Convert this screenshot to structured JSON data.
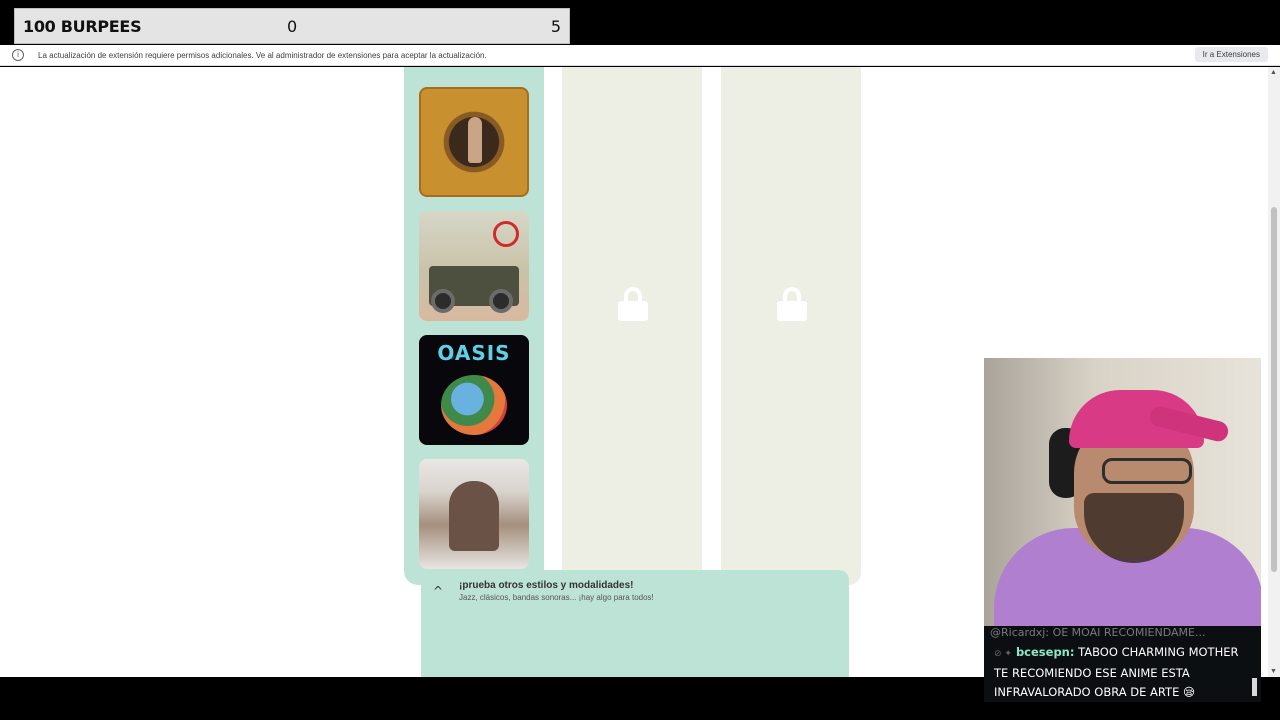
{
  "counter": {
    "label": "100 BURPEES",
    "current": "0",
    "goal": "5"
  },
  "infobar": {
    "icon": "info-icon",
    "message": "La actualización de extensión requiere permisos adicionales. Ve al administrador de extensiones para aceptar la actualización.",
    "button_label": "Ir a Extensiones"
  },
  "albums": [
    {
      "icon": "album-cover-ornate"
    },
    {
      "icon": "album-cover-jeep"
    },
    {
      "title": "OASIS"
    },
    {
      "icon": "album-cover-portrait"
    }
  ],
  "locked_columns": [
    {
      "icon": "lock-icon"
    },
    {
      "icon": "lock-icon"
    }
  ],
  "bottom_panel": {
    "chevron": "^",
    "title": "¡prueba otros estilos y modalidades!",
    "subtitle": "Jazz, clásicos, bandas sonoras... ¡hay algo para todos!"
  },
  "chat": {
    "previous": "@Ricardxj: OE MOAI RECOMIENDAME...",
    "username": "bcesepn:",
    "message": "TABOO CHARMING MOTHER TE RECOMIENDO ESE ANIME ESTA INFRAVALORADO OBRA DE ARTE 😪"
  }
}
